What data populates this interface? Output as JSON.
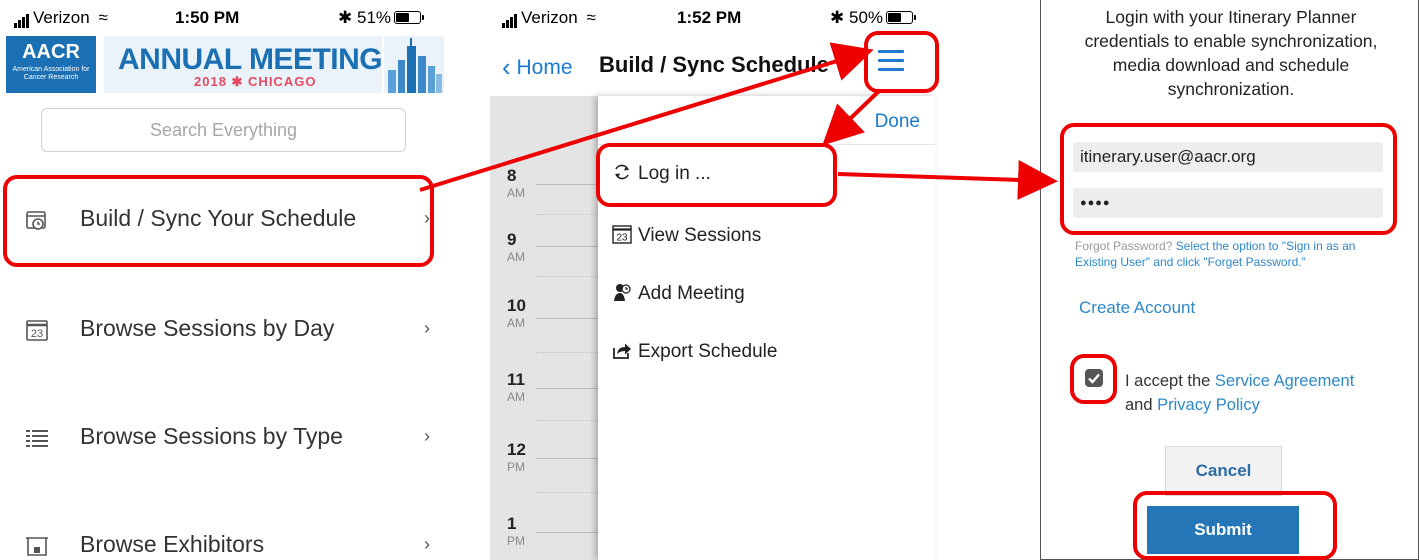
{
  "panel1": {
    "status": {
      "carrier": "Verizon",
      "time": "1:50 PM",
      "battery": "51%"
    },
    "logo": {
      "text": "AACR",
      "subtext": "American Association for Cancer Research"
    },
    "banner": {
      "title": "ANNUAL MEETING",
      "subtitle": "2018 ✱ CHICAGO"
    },
    "search": {
      "placeholder": "Search Everything"
    },
    "menu": [
      {
        "label": "Build / Sync Your Schedule",
        "icon": "calendar-clock-icon"
      },
      {
        "label": "Browse Sessions by Day",
        "icon": "calendar-23-icon"
      },
      {
        "label": "Browse Sessions by Type",
        "icon": "list-icon"
      },
      {
        "label": "Browse Exhibitors",
        "icon": "booth-icon"
      }
    ],
    "chevron": "›"
  },
  "panel2": {
    "status": {
      "carrier": "Verizon",
      "time": "1:52 PM",
      "battery": "50%"
    },
    "back_label": "Home",
    "title": "Build / Sync Schedule",
    "done_label": "Done",
    "hours": [
      {
        "h": "8",
        "p": "AM"
      },
      {
        "h": "9",
        "p": "AM"
      },
      {
        "h": "10",
        "p": "AM"
      },
      {
        "h": "11",
        "p": "AM"
      },
      {
        "h": "12",
        "p": "PM"
      },
      {
        "h": "1",
        "p": "PM"
      }
    ],
    "drawer": [
      {
        "label": "Log in ...",
        "icon": "refresh-icon"
      },
      {
        "label": "View Sessions",
        "icon": "calendar-23-icon"
      },
      {
        "label": "Add Meeting",
        "icon": "meeting-icon"
      },
      {
        "label": "Export Schedule",
        "icon": "share-icon"
      }
    ]
  },
  "panel3": {
    "intro": "Login with your Itinerary Planner credentials to enable synchronization, media download and schedule synchronization.",
    "email_value": "itinerary.user@aacr.org",
    "password_value": "●●●●",
    "forgot_prefix": "Forgot Password?",
    "forgot_link": "Select the option to \"Sign in as an Existing User\" and click \"Forget Password.\"",
    "create_account": "Create Account",
    "accept_prefix": "I accept the",
    "service_agreement": "Service Agreement",
    "and": "and",
    "privacy_policy": "Privacy Policy",
    "cancel_label": "Cancel",
    "submit_label": "Submit"
  },
  "colors": {
    "accent_blue": "#1a7bd1",
    "annotation_red": "#ee0000",
    "submit_blue": "#2476b6"
  }
}
